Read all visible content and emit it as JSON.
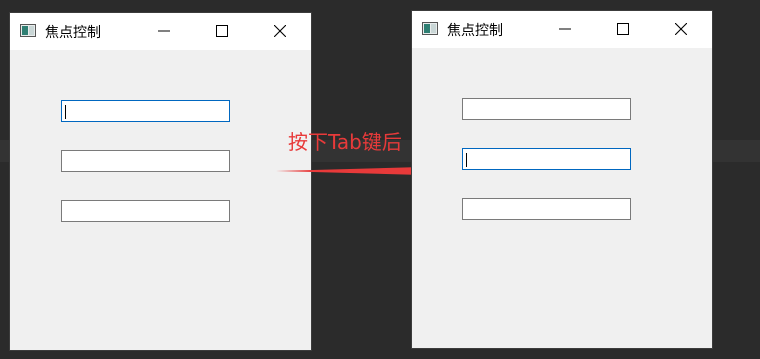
{
  "left_window": {
    "title": "焦点控制",
    "fields": [
      {
        "value": "",
        "focused": true
      },
      {
        "value": "",
        "focused": false
      },
      {
        "value": "",
        "focused": false
      }
    ]
  },
  "right_window": {
    "title": "焦点控制",
    "fields": [
      {
        "value": "",
        "focused": false
      },
      {
        "value": "",
        "focused": true
      },
      {
        "value": "",
        "focused": false
      }
    ]
  },
  "annotation": {
    "text": "按下Tab键后",
    "color": "#e83a3a"
  },
  "colors": {
    "background": "#2b2b2b",
    "window_client": "#f0f0f0",
    "focus_border": "#0067c0"
  },
  "icons": [
    "app-icon",
    "minimize-icon",
    "maximize-icon",
    "close-icon",
    "arrow-right-icon"
  ]
}
